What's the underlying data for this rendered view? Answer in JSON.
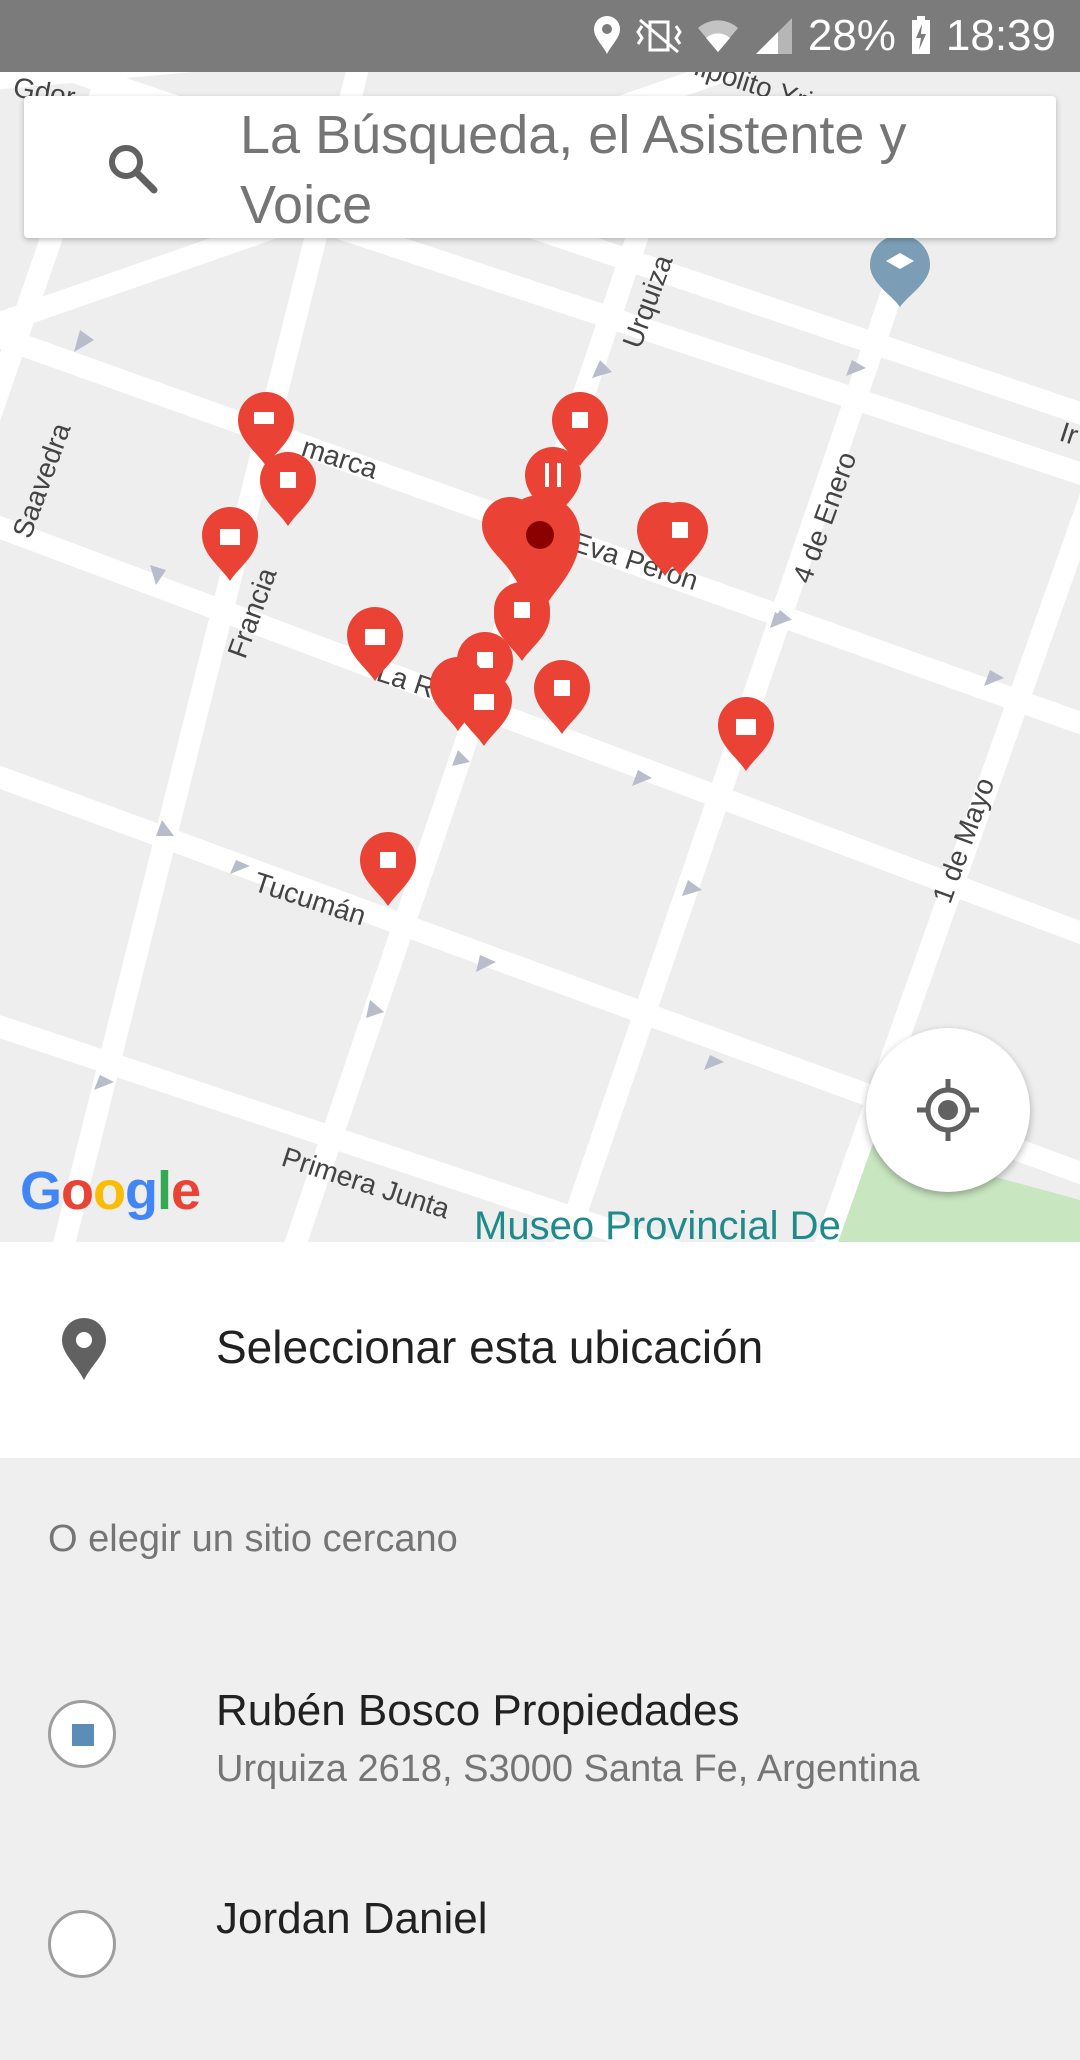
{
  "status_bar": {
    "battery": "28%",
    "time": "18:39",
    "icons": [
      "location-icon",
      "vibrate-icon",
      "wifi-icon",
      "signal-icon",
      "battery-charging-icon"
    ]
  },
  "search": {
    "placeholder": "La Búsqueda, el Asistente y Voice"
  },
  "map": {
    "streets": [
      "Hipólito Yrigoyen",
      "Urquiza",
      "Saavedra",
      "Catamarca",
      "Francia",
      "Eva Perón",
      "4 de Enero",
      "La Rioja",
      "Tucumán",
      "1 de Mayo",
      "Primera Junta",
      "Gdor",
      "Ir"
    ],
    "poi_label": "Museo Provincial De",
    "logo": "Google",
    "colors": {
      "marker": "#ea4335",
      "selected_marker_dot": "#8b0000",
      "road": "#ffffff",
      "park": "#c8e6c0"
    }
  },
  "select_location": {
    "label": "Seleccionar esta ubicación"
  },
  "nearby": {
    "title": "O elegir un sitio cercano",
    "places": [
      {
        "name": "Rubén Bosco Propiedades",
        "address": "Urquiza 2618, S3000 Santa Fe, Argentina"
      },
      {
        "name": "Jordan Daniel",
        "address": ""
      }
    ]
  }
}
